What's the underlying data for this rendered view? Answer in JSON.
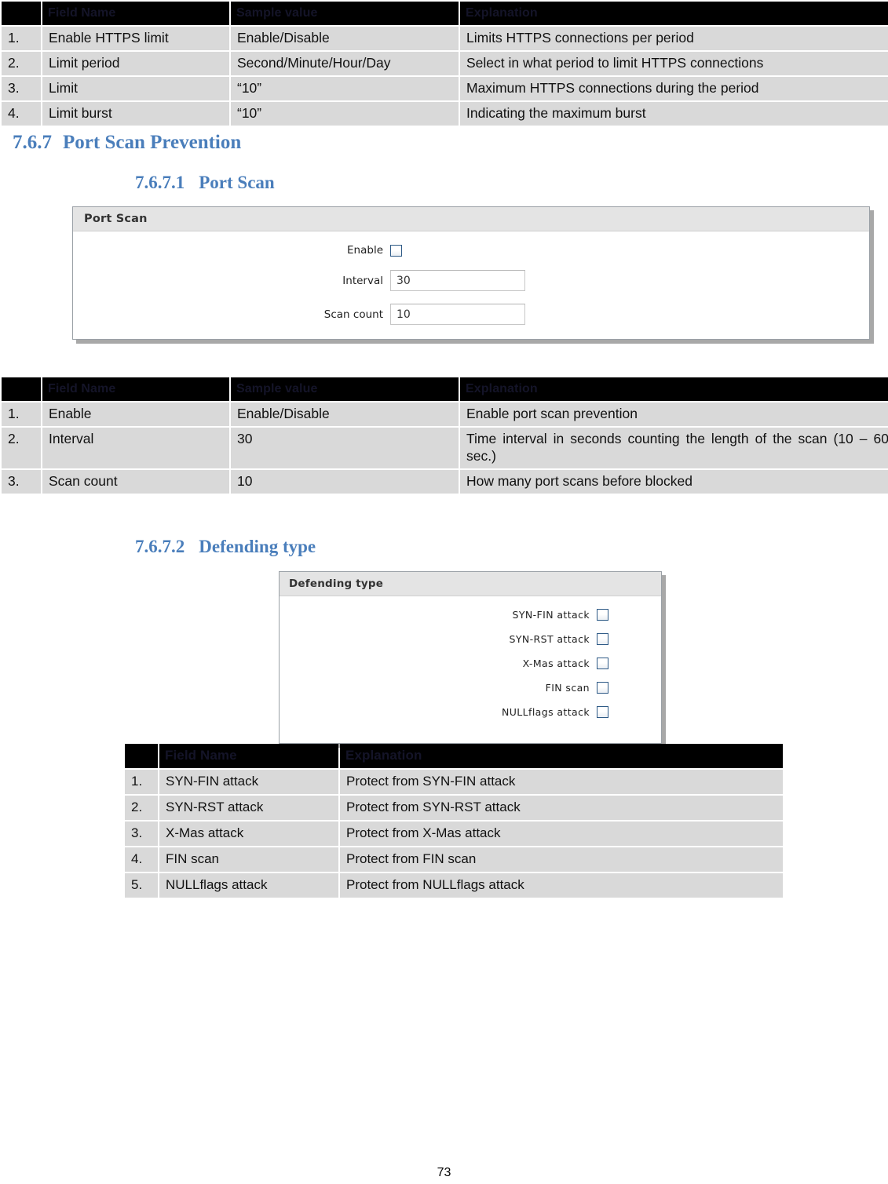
{
  "colors": {
    "heading_blue": "#4a7ebb",
    "table_header_bg": "#000000",
    "table_header_text": "#141428",
    "table_cell_bg": "#d9d9d9",
    "panel_title_bg": "#e4e4e4",
    "checkbox_border": "#2e5a86"
  },
  "table_https_limit": {
    "headers": [
      "",
      "Field Name",
      "Sample value",
      "Explanation"
    ],
    "rows": [
      {
        "num": "1.",
        "field": "Enable HTTPS limit",
        "sample": "Enable/Disable",
        "explanation": "Limits HTTPS connections per period"
      },
      {
        "num": "2.",
        "field": "Limit period",
        "sample": "Second/Minute/Hour/Day",
        "explanation": "Select in what period to limit HTTPS connections"
      },
      {
        "num": "3.",
        "field": "Limit",
        "sample": "“10”",
        "explanation": "Maximum HTTPS connections during the period"
      },
      {
        "num": "4.",
        "field": "Limit burst",
        "sample": "“10”",
        "explanation": "Indicating the maximum burst"
      }
    ]
  },
  "heading_767": {
    "number": "7.6.7",
    "title": "Port Scan Prevention"
  },
  "heading_7671": {
    "number": "7.6.7.1",
    "title": "Port Scan"
  },
  "panel_port_scan": {
    "title": "Port Scan",
    "enable_label": "Enable",
    "enable_checked": false,
    "interval_label": "Interval",
    "interval_value": "30",
    "scan_count_label": "Scan count",
    "scan_count_value": "10"
  },
  "table_port_scan": {
    "headers": [
      "",
      "Field Name",
      "Sample value",
      "Explanation"
    ],
    "rows": [
      {
        "num": "1.",
        "field": "Enable",
        "sample": "Enable/Disable",
        "explanation": "Enable port scan prevention"
      },
      {
        "num": "2.",
        "field": "Interval",
        "sample": "30",
        "explanation": "Time interval in seconds counting the length of the scan (10 – 60 sec.)"
      },
      {
        "num": "3.",
        "field": "Scan count",
        "sample": "10",
        "explanation": "How many port scans before blocked"
      }
    ]
  },
  "heading_7672": {
    "number": "7.6.7.2",
    "title": "Defending type"
  },
  "panel_defending": {
    "title": "Defending type",
    "items": [
      {
        "label": "SYN-FIN attack",
        "checked": false
      },
      {
        "label": "SYN-RST attack",
        "checked": false
      },
      {
        "label": "X-Mas attack",
        "checked": false
      },
      {
        "label": "FIN scan",
        "checked": false
      },
      {
        "label": "NULLflags attack",
        "checked": false
      }
    ]
  },
  "table_defending": {
    "headers": [
      "",
      "Field Name",
      "Explanation"
    ],
    "rows": [
      {
        "num": "1.",
        "field": "SYN-FIN attack",
        "explanation": "Protect from SYN-FIN attack"
      },
      {
        "num": "2.",
        "field": "SYN-RST attack",
        "explanation": "Protect from SYN-RST attack"
      },
      {
        "num": "3.",
        "field": "X-Mas attack",
        "explanation": "Protect from X-Mas attack"
      },
      {
        "num": "4.",
        "field": "FIN scan",
        "explanation": "Protect from FIN scan"
      },
      {
        "num": "5.",
        "field": "NULLflags attack",
        "explanation": "Protect from NULLflags attack"
      }
    ]
  },
  "footer": {
    "page_number": "73"
  }
}
